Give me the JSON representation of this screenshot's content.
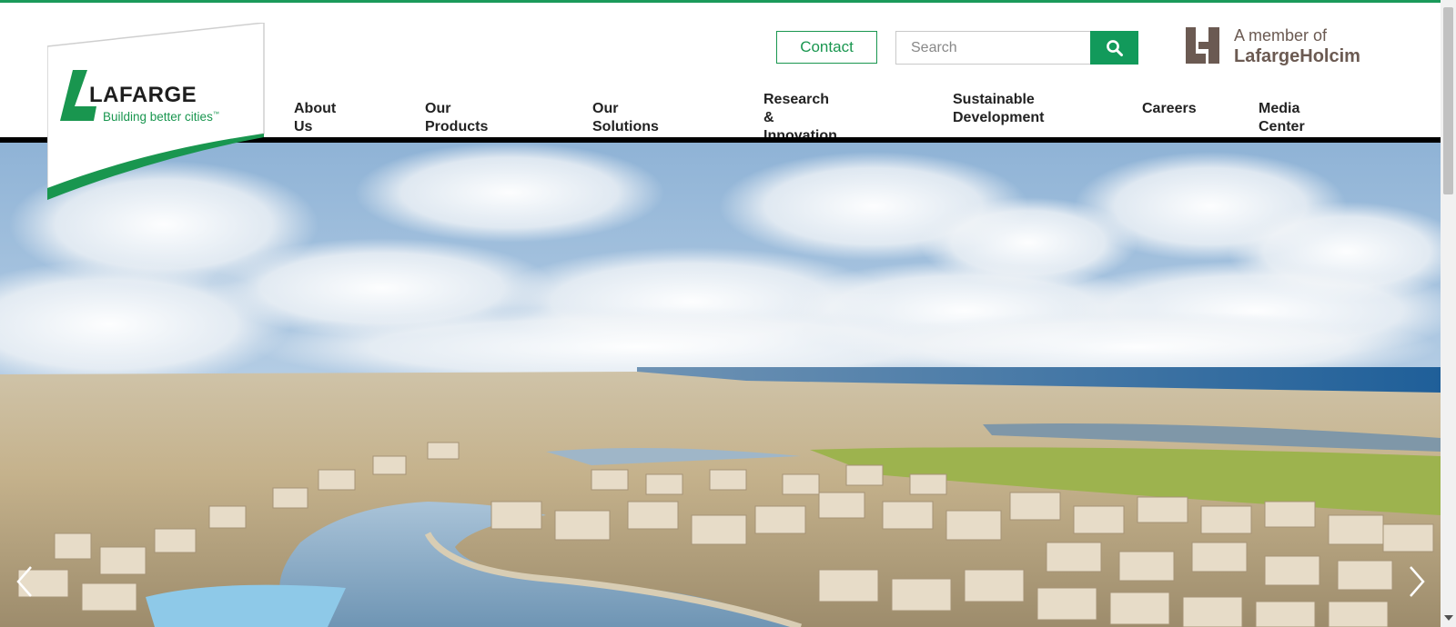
{
  "header": {
    "logo": {
      "wordmark": "LAFARGE",
      "tagline": "Building better cities",
      "tm": "™"
    },
    "contact_label": "Contact",
    "search": {
      "placeholder": "Search",
      "value": ""
    },
    "member": {
      "line1": "A member of",
      "line2": "LafargeHolcim"
    }
  },
  "nav": {
    "items": [
      {
        "label": "About Us"
      },
      {
        "label": "Our Products"
      },
      {
        "label": "Our Solutions"
      },
      {
        "label_line1": "Research &",
        "label_line2": "Innovation"
      },
      {
        "label_line1": "Sustainable",
        "label_line2": "Development"
      },
      {
        "label": "Careers"
      },
      {
        "label": "Media Center"
      }
    ]
  },
  "hero": {
    "image": "aerial view of coastal residential community with lagoon, golf course and sea",
    "prev_icon": "chevron-left-icon",
    "next_icon": "chevron-right-icon"
  },
  "colors": {
    "brand_green": "#19964f",
    "button_green": "#129a5b",
    "member_brown": "#6b5a52",
    "rule_black": "#000000"
  }
}
